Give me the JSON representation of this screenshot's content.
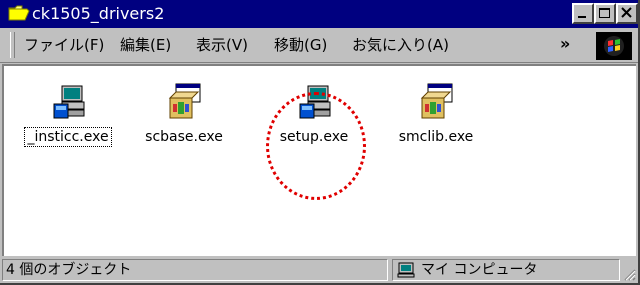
{
  "window": {
    "title": "ck1505_drivers2",
    "folder_icon": "open-folder-icon",
    "controls": [
      "minimize-icon",
      "maximize-icon",
      "close-icon"
    ]
  },
  "menu": {
    "items": [
      "ファイル(F)",
      "編集(E)",
      "表示(V)",
      "移動(G)",
      "お気に入り(A)"
    ],
    "overflow": "»",
    "logo_icon": "windows-logo-icon"
  },
  "files": [
    {
      "name": "_insticc.exe",
      "icon": "setup-computer-icon"
    },
    {
      "name": "scbase.exe",
      "icon": "installer-box-icon"
    },
    {
      "name": "setup.exe",
      "icon": "setup-computer-icon"
    },
    {
      "name": "smclib.exe",
      "icon": "installer-box-icon"
    }
  ],
  "annotation": {
    "shape": "dotted-circle",
    "color": "#e00000",
    "target": "setup.exe"
  },
  "status": {
    "count": "4 個のオブジェクト",
    "location": "マイ コンピュータ",
    "location_icon": "my-computer-icon"
  },
  "colors": {
    "titlebar": "#000080",
    "chrome": "#c0c0c0",
    "highlight": "#e00000"
  }
}
